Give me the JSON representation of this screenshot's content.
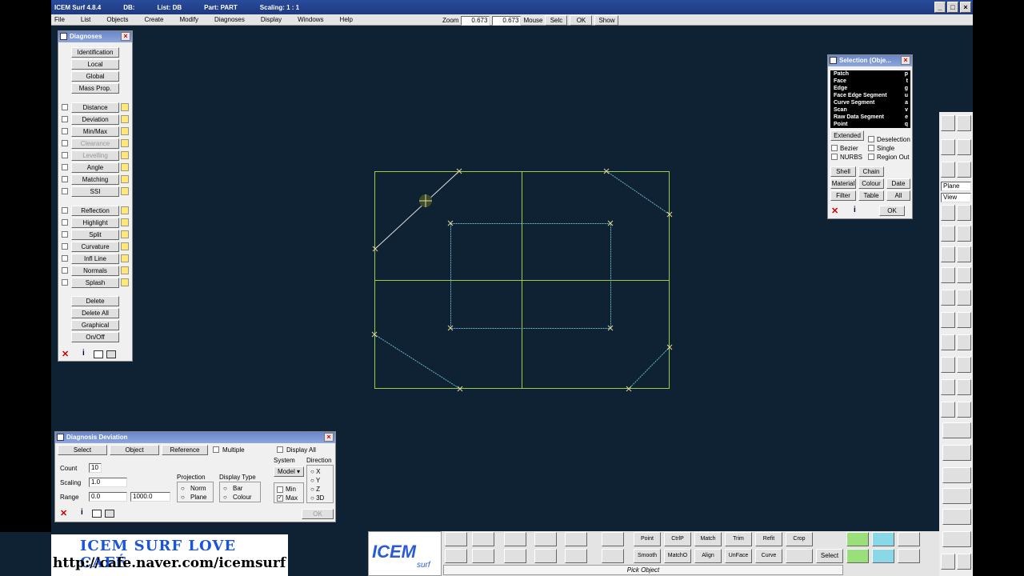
{
  "titlebar": {
    "app": "ICEM Surf 4.8.4",
    "db": "DB:",
    "list": "List: DB",
    "part": "Part: PART",
    "scaling": "Scaling: 1 : 1"
  },
  "menu": [
    "File",
    "List",
    "Objects",
    "Create",
    "Modify",
    "Diagnoses",
    "Display",
    "Windows",
    "Help"
  ],
  "zoom": {
    "label": "Zoom",
    "value1": "0.673",
    "value2": "0.673",
    "mouse_label": "Mouse",
    "selc": "Selc",
    "ok": "OK",
    "show": "Show"
  },
  "diagnoses": {
    "title": "Diagnoses",
    "top_buttons": [
      "Identification",
      "Local",
      "Global",
      "Mass Prop."
    ],
    "group1": [
      "Distance",
      "Deviation",
      "Min/Max",
      "Clearance",
      "Levelling",
      "Angle",
      "Matching",
      "SSI"
    ],
    "group2": [
      "Reflection",
      "Highlight",
      "Split",
      "Curvature",
      "Infl Line",
      "Normals",
      "Splash"
    ],
    "bottom_buttons": [
      "Delete",
      "Delete All",
      "Graphical",
      "On/Off"
    ],
    "info": "i"
  },
  "selection": {
    "title": "Selection (Obje...",
    "rows": [
      {
        "label": "Patch",
        "key": "p"
      },
      {
        "label": "Face",
        "key": "t"
      },
      {
        "label": "Edge",
        "key": "g"
      },
      {
        "label": "Face Edge Segment",
        "key": "u"
      },
      {
        "label": "Curve Segment",
        "key": "a"
      },
      {
        "label": "Scan",
        "key": "v"
      },
      {
        "label": "Raw Data Segment",
        "key": "e"
      },
      {
        "label": "Point",
        "key": "q"
      }
    ],
    "extended": "Extended",
    "deselection": "Deselection",
    "bezier": "Bezier",
    "single": "Single",
    "nurbs": "NURBS",
    "region_out": "Region Out",
    "shell": "Shell",
    "chain": "Chain",
    "material": "Material",
    "colour": "Colour",
    "date": "Date",
    "filter": "Filter",
    "table": "Table",
    "all": "All",
    "ok": "OK",
    "info": "i"
  },
  "deviation": {
    "title": "Diagnosis Deviation",
    "select": "Select",
    "object": "Object",
    "reference": "Reference",
    "multiple": "Multiple",
    "display_all": "Display All",
    "count_label": "Count",
    "count_value": "10",
    "scaling_label": "Scaling",
    "scaling_value": "1.0",
    "range_label": "Range",
    "range_min": "0.0",
    "range_max": "1000.0",
    "projection_label": "Projection",
    "norm": "Norm",
    "plane": "Plane",
    "display_type_label": "Display Type",
    "bar": "Bar",
    "colour": "Colour",
    "system_label": "System",
    "system_value": "Model",
    "min": "Min",
    "max": "Max",
    "direction_label": "Direction",
    "dirs": [
      "X",
      "Y",
      "Z",
      "3D"
    ],
    "ok": "OK",
    "info": "i"
  },
  "banner": {
    "line1": "ICEM SURF LOVE  CAFÉ",
    "line2": "http://cafe.naver.com/icemsurf"
  },
  "logo": {
    "text1": "ICEM",
    "text2": "surf"
  },
  "bottom_tools": {
    "row1": [
      "Point",
      "CtrlP",
      "Match",
      "Trim",
      "Refit",
      "Crop"
    ],
    "row2": [
      "Smooth",
      "MatchO",
      "Align",
      "UnFace",
      "Curve",
      ""
    ],
    "select": "Select"
  },
  "status": "Pick Object",
  "right_tools": {
    "plane": "Plane",
    "view": "View"
  },
  "colors": {
    "canvas": "#0e2233",
    "frame": "#9ccc4a",
    "curve": "#6ab4c8",
    "selected": "#e0e0e0",
    "handle": "#e8d89a"
  }
}
